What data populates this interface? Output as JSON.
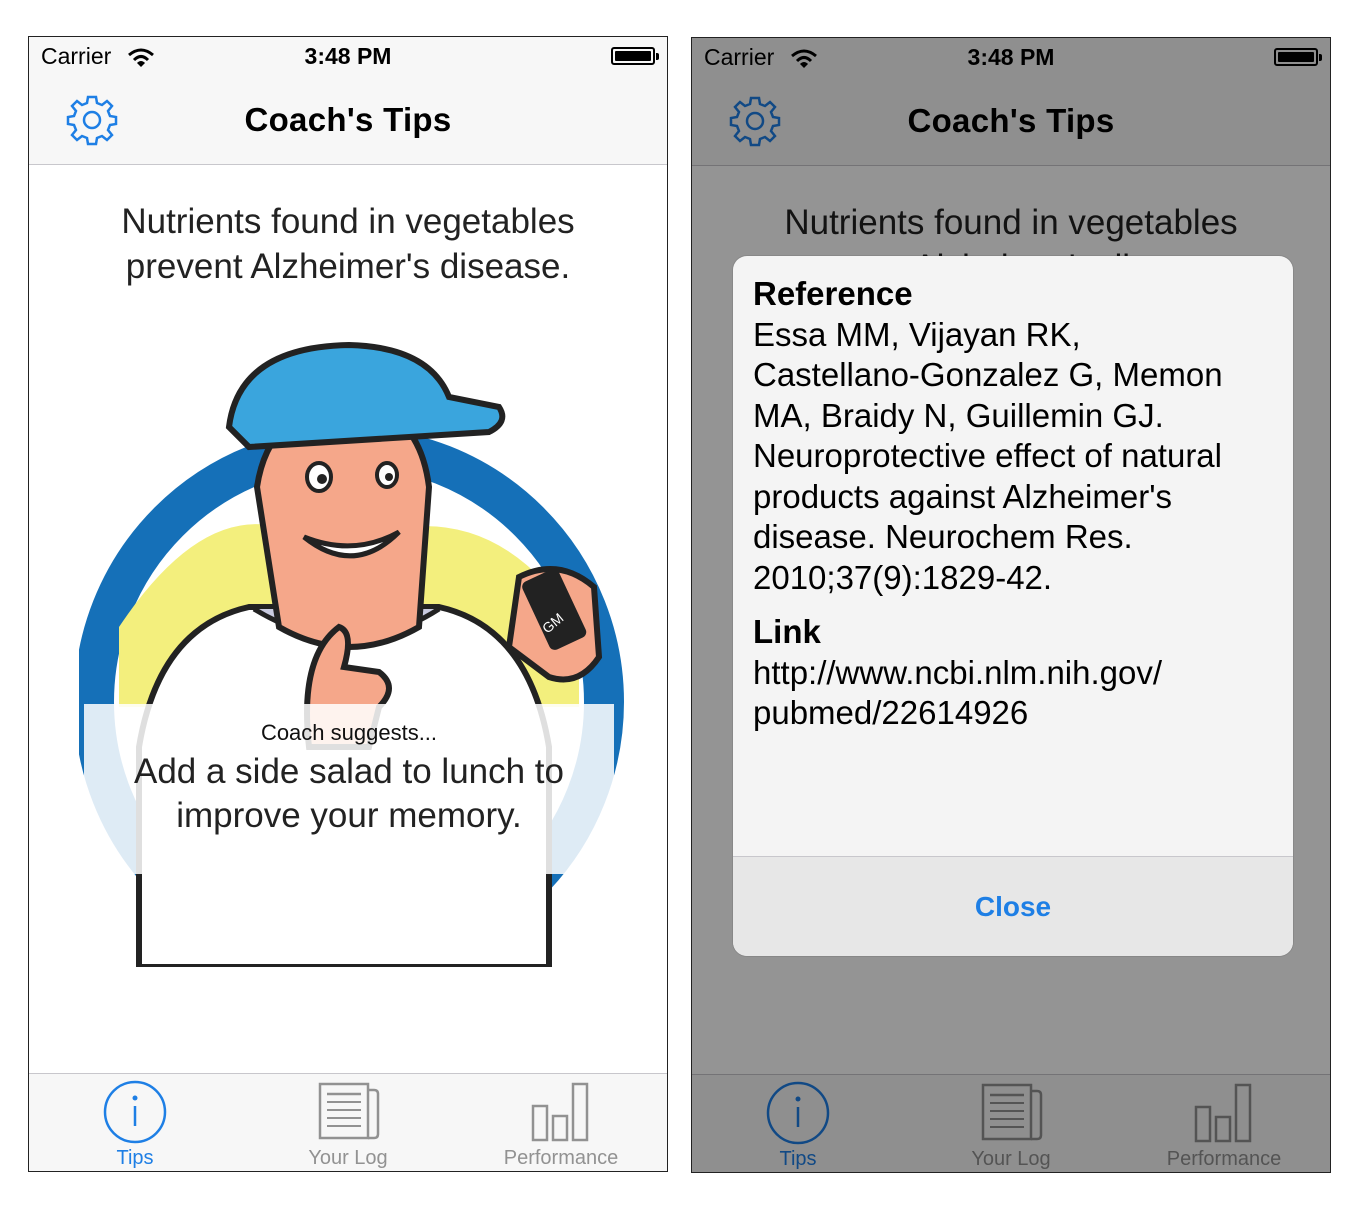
{
  "colors": {
    "accent": "#1e7fe5",
    "inactive": "#929292",
    "bar_bg": "#f7f7f7",
    "coach_cap": "#3aa5dd",
    "coach_ring": "#1570b8",
    "coach_bg_yellow": "#f3ef7d"
  },
  "status": {
    "carrier": "Carrier",
    "time": "3:48 PM",
    "wifi_icon": "wifi-icon",
    "battery_icon": "battery-icon"
  },
  "nav": {
    "title": "Coach's Tips",
    "settings_icon": "gear-icon"
  },
  "tip": {
    "fact_line1": "Nutrients found in vegetables",
    "fact_line2": "prevent Alzheimer's disease.",
    "suggest_label": "Coach suggests...",
    "suggest_line1": "Add a side salad to lunch to",
    "suggest_line2": "improve your memory.",
    "coach_badge": "GM"
  },
  "tabs": [
    {
      "label": "Tips",
      "icon": "info-icon",
      "active": true
    },
    {
      "label": "Your Log",
      "icon": "log-icon",
      "active": false
    },
    {
      "label": "Performance",
      "icon": "bar-chart-icon",
      "active": false
    }
  ],
  "reference_alert": {
    "reference_heading": "Reference",
    "reference_lines": [
      "Essa MM, Vijayan RK,",
      "Castellano-Gonzalez G, Memon",
      "MA, Braidy N, Guillemin GJ.",
      "Neuroprotective effect of natural",
      "products against Alzheimer's",
      "disease. Neurochem Res.",
      "2010;37(9):1829-42."
    ],
    "link_heading": "Link",
    "link_lines": [
      "http://www.ncbi.nlm.nih.gov/",
      "pubmed/22614926"
    ],
    "close_label": "Close"
  }
}
